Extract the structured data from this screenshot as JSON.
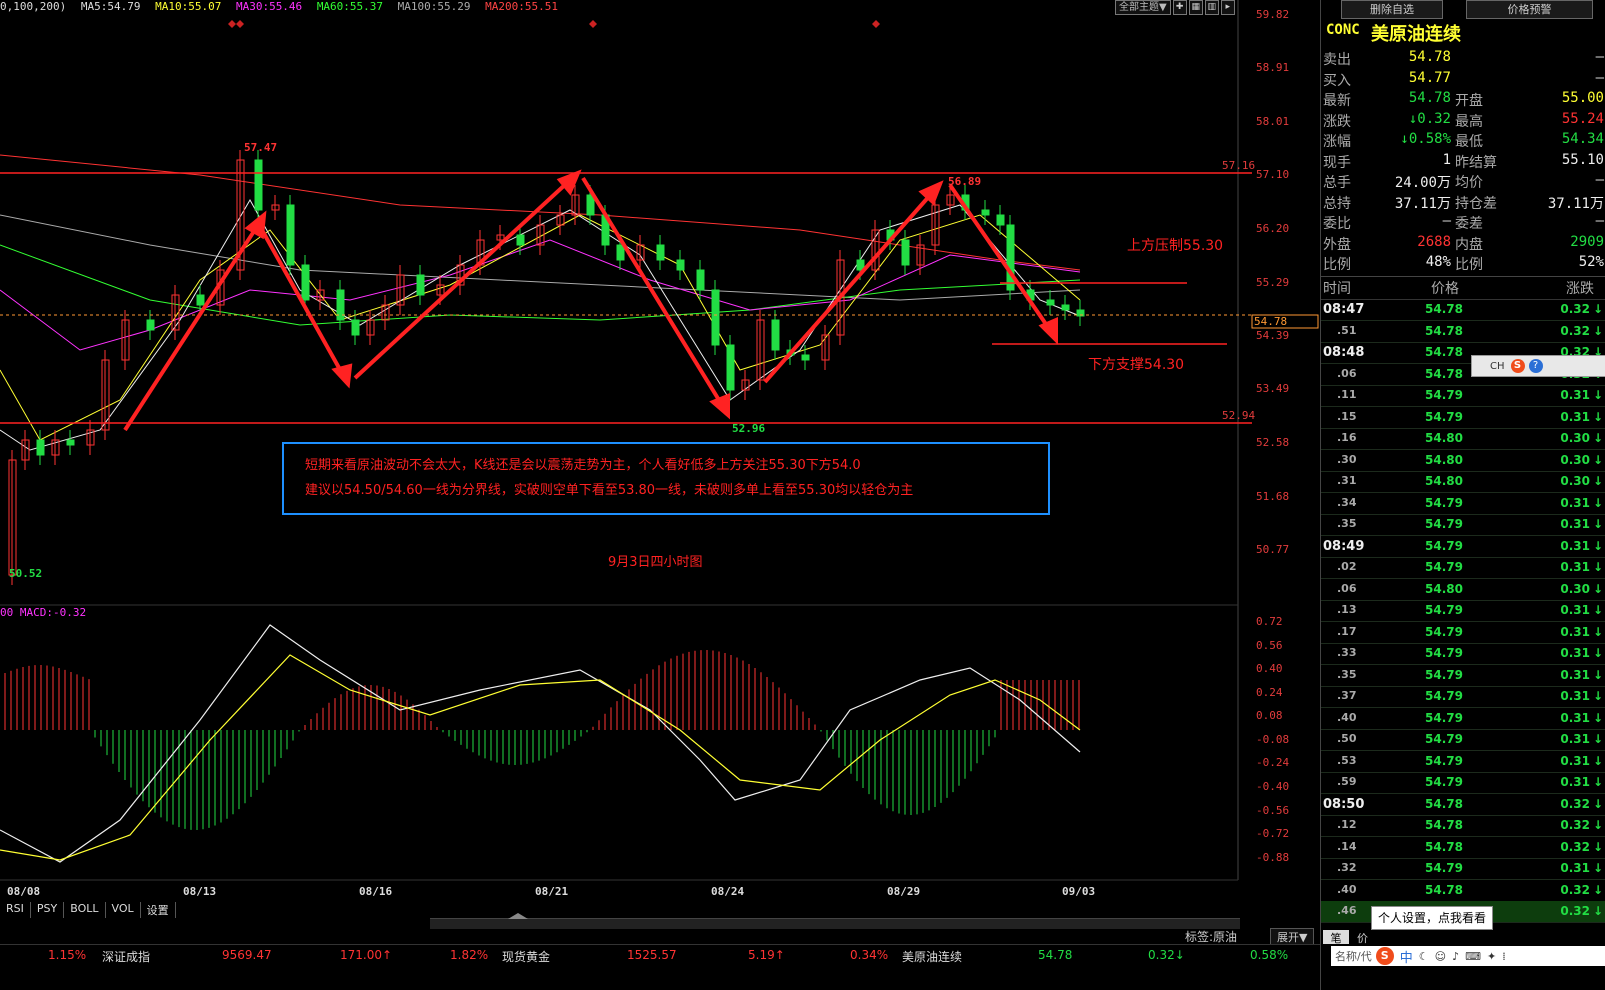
{
  "chart": {
    "ma_legend": [
      {
        "text": "0,100,200)",
        "color": "#dddddd"
      },
      {
        "text": "MA5:54.79",
        "color": "#dddddd"
      },
      {
        "text": "MA10:55.07",
        "color": "#ffff33"
      },
      {
        "text": "MA30:55.46",
        "color": "#ff33ff"
      },
      {
        "text": "MA60:55.37",
        "color": "#33ff33"
      },
      {
        "text": "MA100:55.29",
        "color": "#aaaaaa"
      },
      {
        "text": "MA200:55.51",
        "color": "#ff4444"
      }
    ],
    "toolbar_label": "全部主题▼",
    "y_labels": [
      "59.82",
      "58.91",
      "58.01",
      "57.10",
      "56.20",
      "55.29",
      "54.39",
      "53.49",
      "52.58",
      "51.68",
      "50.77"
    ],
    "price_marker": "54.78",
    "level_high": "57.16",
    "level_low": "52.94",
    "peak_labels": {
      "p1": "57.47",
      "p2": "56.89",
      "trough": "52.96",
      "low": "50.52"
    },
    "annotations": {
      "resistance": "上方压制55.30",
      "support": "下方支撑54.30",
      "caption": "9月3日四小时图",
      "box_line1": "短期来看原油波动不会太大，K线还是会以震荡走势为主，个人看好低多上方关注55.30下方54.0",
      "box_line2": "建议以54.50/54.60一线为分界线，实破则空单下看至53.80一线，未破则多单上看至55.30均以轻仓为主"
    },
    "macd_legend": "00  MACD:-0.32",
    "macd_y_labels": [
      "0.72",
      "0.56",
      "0.40",
      "0.24",
      "0.08",
      "-0.08",
      "-0.24",
      "-0.40",
      "-0.56",
      "-0.72",
      "-0.88"
    ],
    "x_labels": [
      "08/08",
      "08/13",
      "08/16",
      "08/21",
      "08/24",
      "08/29",
      "09/03"
    ],
    "bottom_tabs": [
      "RSI",
      "PSY",
      "BOLL",
      "VOL",
      "设置"
    ],
    "tag_label": "标签:原油",
    "expand_label": "展开▼"
  },
  "ticker": [
    {
      "text": "1.15%",
      "color": "#ff3333"
    },
    {
      "text": "深证成指",
      "color": "#dddddd"
    },
    {
      "text": "9569.47",
      "color": "#ff3333"
    },
    {
      "text": "171.00↑",
      "color": "#ff3333"
    },
    {
      "text": "1.82%",
      "color": "#ff3333"
    },
    {
      "text": "现货黄金",
      "color": "#dddddd"
    },
    {
      "text": "1525.57",
      "color": "#ff3333"
    },
    {
      "text": "5.19↑",
      "color": "#ff3333"
    },
    {
      "text": "0.34%",
      "color": "#ff3333"
    },
    {
      "text": "美原油连续",
      "color": "#dddddd"
    },
    {
      "text": "54.78",
      "color": "#22dd44"
    },
    {
      "text": "0.32↓",
      "color": "#22dd44"
    },
    {
      "text": "0.58%",
      "color": "#22dd44"
    }
  ],
  "quote": {
    "btn_delete": "删除自选",
    "btn_alert": "价格预警",
    "code": "CONC",
    "name": "美原油连续",
    "rows": [
      {
        "l1": "卖出",
        "v1": "54.78",
        "c1": "#ffff33",
        "l2": "",
        "v2": "—",
        "c2": "#dddddd",
        "extra": ""
      },
      {
        "l1": "买入",
        "v1": "54.77",
        "c1": "#ffff33",
        "l2": "",
        "v2": "—",
        "c2": "#dddddd",
        "extra": ""
      },
      {
        "l1": "最新",
        "v1": "54.78",
        "c1": "#22dd44",
        "l2": "开盘",
        "v2": "55.00",
        "c2": "#ffff33"
      },
      {
        "l1": "涨跌",
        "v1": "↓0.32",
        "c1": "#22dd44",
        "l2": "最高",
        "v2": "55.24",
        "c2": "#ff3333"
      },
      {
        "l1": "涨幅",
        "v1": "↓0.58%",
        "c1": "#22dd44",
        "l2": "最低",
        "v2": "54.34",
        "c2": "#22dd44"
      },
      {
        "l1": "现手",
        "v1": "1",
        "c1": "#eeeeee",
        "l2": "昨结算",
        "v2": "55.10",
        "c2": "#eeeeee"
      },
      {
        "l1": "总手",
        "v1": "24.00万",
        "c1": "#eeeeee",
        "l2": "均价",
        "v2": "—",
        "c2": "#dddddd"
      },
      {
        "l1": "总持",
        "v1": "37.11万",
        "c1": "#eeeeee",
        "l2": "持仓差",
        "v2": "37.11万",
        "c2": "#eeeeee"
      },
      {
        "l1": "委比",
        "v1": "—",
        "c1": "#dddddd",
        "l2": "委差",
        "v2": "—",
        "c2": "#dddddd"
      },
      {
        "l1": "外盘",
        "v1": "2688",
        "c1": "#ff3333",
        "l2": "内盘",
        "v2": "2909",
        "c2": "#22dd44"
      },
      {
        "l1": "比例",
        "v1": "48%",
        "c1": "#eeeeee",
        "l2": "比例",
        "v2": "52%",
        "c2": "#eeeeee"
      }
    ],
    "tick_header": {
      "time": "时间",
      "price": "价格",
      "change": "涨跌"
    },
    "ticks": [
      {
        "t": "08:47",
        "p": "54.78",
        "c": "0.32"
      },
      {
        "t": ".51",
        "p": "54.78",
        "c": "0.32"
      },
      {
        "t": "08:48",
        "p": "54.78",
        "c": "0.32"
      },
      {
        "t": ".06",
        "p": "54.78",
        "c": "0.32"
      },
      {
        "t": ".11",
        "p": "54.79",
        "c": "0.31"
      },
      {
        "t": ".15",
        "p": "54.79",
        "c": "0.31"
      },
      {
        "t": ".16",
        "p": "54.80",
        "c": "0.30"
      },
      {
        "t": ".30",
        "p": "54.80",
        "c": "0.30"
      },
      {
        "t": ".31",
        "p": "54.80",
        "c": "0.30"
      },
      {
        "t": ".34",
        "p": "54.79",
        "c": "0.31"
      },
      {
        "t": ".35",
        "p": "54.79",
        "c": "0.31"
      },
      {
        "t": "08:49",
        "p": "54.79",
        "c": "0.31"
      },
      {
        "t": ".02",
        "p": "54.79",
        "c": "0.31"
      },
      {
        "t": ".06",
        "p": "54.80",
        "c": "0.30"
      },
      {
        "t": ".13",
        "p": "54.79",
        "c": "0.31"
      },
      {
        "t": ".17",
        "p": "54.79",
        "c": "0.31"
      },
      {
        "t": ".33",
        "p": "54.79",
        "c": "0.31"
      },
      {
        "t": ".35",
        "p": "54.79",
        "c": "0.31"
      },
      {
        "t": ".37",
        "p": "54.79",
        "c": "0.31"
      },
      {
        "t": ".40",
        "p": "54.79",
        "c": "0.31"
      },
      {
        "t": ".50",
        "p": "54.79",
        "c": "0.31"
      },
      {
        "t": ".53",
        "p": "54.79",
        "c": "0.31"
      },
      {
        "t": ".59",
        "p": "54.79",
        "c": "0.31"
      },
      {
        "t": "08:50",
        "p": "54.78",
        "c": "0.32"
      },
      {
        "t": ".12",
        "p": "54.78",
        "c": "0.32"
      },
      {
        "t": ".14",
        "p": "54.78",
        "c": "0.32"
      },
      {
        "t": ".32",
        "p": "54.79",
        "c": "0.31"
      },
      {
        "t": ".40",
        "p": "54.78",
        "c": "0.32"
      },
      {
        "t": ".46",
        "p": "",
        "c": "0.32"
      }
    ],
    "tooltip": "个人设置，点我看看",
    "ime_label": "CH",
    "pen_label": "笔",
    "price_tab": "价",
    "name_search": "名称/代",
    "ime_mode": "中"
  }
}
